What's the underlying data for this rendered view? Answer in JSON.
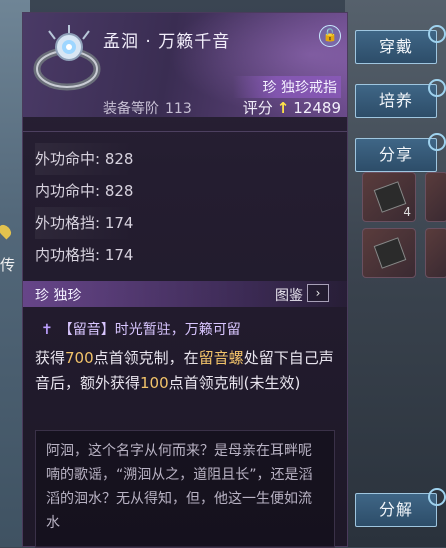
{
  "item": {
    "title": "孟洄 · 万籁千音",
    "rarity_type": "珍 独珍戒指",
    "rank_label": "装备等阶",
    "rank_value": "113",
    "score_label": "评分",
    "score_arrow": "↑",
    "score_value": "12489",
    "lock_icon": "lock-icon"
  },
  "stats": [
    {
      "label": "外功命中: 828"
    },
    {
      "label": "内功命中: 828"
    },
    {
      "label": "外功格挡: 174"
    },
    {
      "label": "内功格挡: 174"
    }
  ],
  "rarity_bar": {
    "label": "珍  独珍",
    "codex_label": "图鉴",
    "codex_icon": "arrow-right-icon"
  },
  "skill": {
    "icon": "sword-icon",
    "name": "【留音】时光暂驻，万籁可留",
    "desc_1": "获得",
    "desc_2": "700",
    "desc_3": "点首领克制，在",
    "desc_4": "留音螺",
    "desc_5": "处留下自己声音后，额外获得",
    "desc_6": "100",
    "desc_7": "点首领克制(未生效)"
  },
  "lore": "阿洄，这个名字从何而来？是母亲在耳畔呢喃的歌谣，“溯洄从之，道阻且长”，还是滔滔的洄水？无从得知，但，他这一生便如流水",
  "buttons": {
    "equip": "穿戴",
    "cultivate": "培养",
    "share": "分享",
    "dismantle": "分解"
  },
  "background": {
    "left_label": "传",
    "slot_count_1": "4"
  },
  "colors": {
    "highlight": "#f2c36a",
    "score_arrow": "#ffe34a",
    "button_bg": "#2d4d69"
  }
}
